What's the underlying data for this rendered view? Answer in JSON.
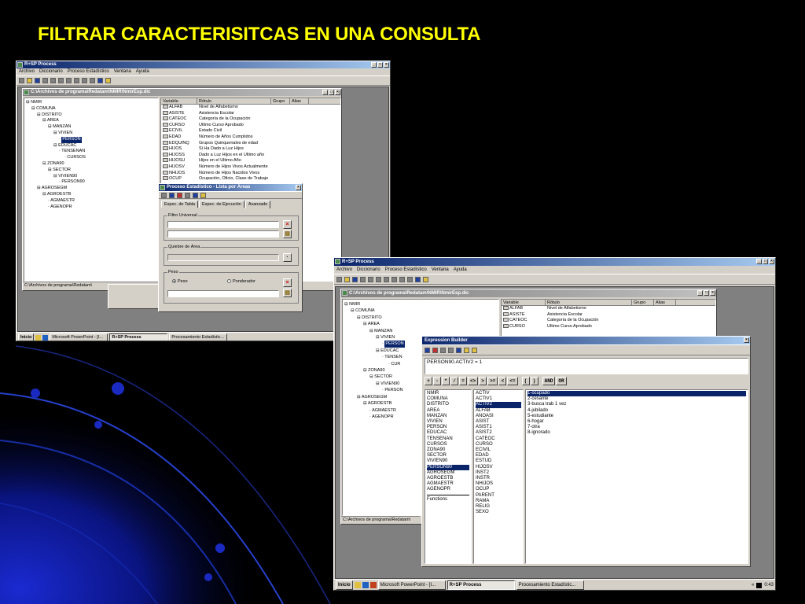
{
  "slide_title": "FILTRAR CARACTERISITCAS EN UNA CONSULTA",
  "colors": {
    "title": "#ffff00",
    "titlebar": "#0a246a",
    "window": "#d4d0c8",
    "desktop": "#808080"
  },
  "app": {
    "title": "R+SP Process",
    "menu": [
      "Archivo",
      "Diccionario",
      "Proceso Estadístico",
      "Ventana",
      "Ayuda"
    ]
  },
  "dict_window_1": {
    "title": "C:\\Archivos de programa\\Redatam\\NMIR\\NmirEsp.dic"
  },
  "dict_window_2": {
    "title": "C:\\Archivos de programa\\Redatam\\NMIR\\NmirEsp.dic"
  },
  "tree": [
    {
      "label": "NMIR",
      "level": 0
    },
    {
      "label": "COMUNA",
      "level": 1
    },
    {
      "label": "DISTRITO",
      "level": 2
    },
    {
      "label": "AREA",
      "level": 3
    },
    {
      "label": "MANZAN",
      "level": 4
    },
    {
      "label": "VIVIEN",
      "level": 5
    },
    {
      "label": "PERSON",
      "level": 6,
      "selected": true
    },
    {
      "label": "EDUCAC",
      "level": 5
    },
    {
      "label": "TENSENAN",
      "level": 6
    },
    {
      "label": "CURSOS",
      "level": 7
    },
    {
      "label": "ZONA90",
      "level": 3
    },
    {
      "label": "SECTOR",
      "level": 4
    },
    {
      "label": "VIVIEN90",
      "level": 5
    },
    {
      "label": "PERSON90",
      "level": 6
    },
    {
      "label": "AGROSEGM",
      "level": 2
    },
    {
      "label": "AGROESTB",
      "level": 3
    },
    {
      "label": "AGMAESTR",
      "level": 4
    },
    {
      "label": "AGENOPR",
      "level": 4
    }
  ],
  "tree2": [
    {
      "label": "NMIR",
      "level": 0
    },
    {
      "label": "COMUNA",
      "level": 1
    },
    {
      "label": "DISTRITO",
      "level": 2
    },
    {
      "label": "AREA",
      "level": 3
    },
    {
      "label": "MANZAN",
      "level": 4
    },
    {
      "label": "VIVIEN",
      "level": 5
    },
    {
      "label": "PERSON",
      "level": 6,
      "selected": true
    },
    {
      "label": "EDUCAC",
      "level": 5
    },
    {
      "label": "TENSEN",
      "level": 6
    },
    {
      "label": "CUR",
      "level": 7
    },
    {
      "label": "ZONA90",
      "level": 3
    },
    {
      "label": "SECTOR",
      "level": 4
    },
    {
      "label": "VIVIEN90",
      "level": 5
    },
    {
      "label": "PERSON",
      "level": 6
    },
    {
      "label": "AGROSEGM",
      "level": 2
    },
    {
      "label": "AGROESTB",
      "level": 3
    },
    {
      "label": "AGMAESTR",
      "level": 4
    },
    {
      "label": "AGENOPR",
      "level": 4
    }
  ],
  "var_columns": [
    "Variable",
    "Rótulo",
    "Grupo",
    "Alias"
  ],
  "variables": [
    {
      "name": "ALFAB",
      "label": "Nivel de Alfabetismo"
    },
    {
      "name": "ASISTE",
      "label": "Asistencia Escolar"
    },
    {
      "name": "CATEOC",
      "label": "Categoría de la Ocupación"
    },
    {
      "name": "CURSO",
      "label": "Ultimo Curso Aprobado"
    },
    {
      "name": "ECIVIL",
      "label": "Estado Civil"
    },
    {
      "name": "EDAD",
      "label": "Número de Años Cumplidos"
    },
    {
      "name": "EDQUINQ",
      "label": "Grupos Quinquenales de edad"
    },
    {
      "name": "HIJOS",
      "label": "Si Ha Dado a Luz Hijos"
    },
    {
      "name": "HIJOSS",
      "label": "Dado a Luz Hijos en el Ultimo año"
    },
    {
      "name": "HIJOSU",
      "label": "Hijos en el Ultimo Año"
    },
    {
      "name": "HIJOSV",
      "label": "Número de Hijos Vivos Actualmente"
    },
    {
      "name": "NHIJOS",
      "label": "Número de Hijos Nacidos Vivos"
    },
    {
      "name": "OCUP",
      "label": "Ocupación, Oficio, Clase de Trabajo"
    }
  ],
  "variables2": [
    {
      "name": "ALFAB",
      "label": "Nivel de Alfabetismo"
    },
    {
      "name": "ASISTE",
      "label": "Asistencia Escolar"
    },
    {
      "name": "CATEOC",
      "label": "Categoría de la Ocupación"
    },
    {
      "name": "CURSO",
      "label": "Ultimo Curso Aprobado"
    }
  ],
  "status_path": "C:\\Archivos de programa\\Redatam\\",
  "proc_dialog": {
    "title": "Proceso Estadístico - Lista por Áreas",
    "tabs": [
      "Espec. de Tabla",
      "Espec. de Ejecución",
      "Avanzado"
    ],
    "active_tab": 2,
    "filtro_label": "Filtro Universal",
    "quiebre_label": "Quiebre de Área",
    "peso_label": "Peso",
    "radio_peso": "Peso",
    "radio_ponderador": "Ponderador"
  },
  "expr_builder": {
    "title": "Expression Builder",
    "expression": "PERSON90.ACTIV2 = 1",
    "operators": [
      "+",
      "-",
      "*",
      "/",
      "=",
      "<>",
      ">",
      ">=",
      "<",
      "<=",
      "(",
      ")",
      "AND",
      "OR"
    ],
    "entities": [
      "NMIR",
      "COMUNA",
      "DISTRITO",
      "AREA",
      "MANZAN",
      "VIVIEN",
      "PERSON",
      "EDUCAC",
      "TENSENAN",
      "CURSOS",
      "ZONA90",
      "SECTOR",
      "VIVIEN90",
      "PERSON90",
      "AGROSEGM",
      "AGROESTB",
      "AGMAESTR",
      "AGENOPR"
    ],
    "entities_selected": 13,
    "functions_label": "Functions",
    "variables": [
      "ACTIV",
      "ACTIV1",
      "ACTIV2",
      "ALFAB",
      "ANOASI",
      "ASIST",
      "ASIST1",
      "ASIST2",
      "CATEOC",
      "CURSO",
      "ECIVIL",
      "EDAD",
      "ESTUD",
      "HIJOSV",
      "INST2",
      "INSTR",
      "NHIJOS",
      "OCUP",
      "PARENT",
      "RAMA",
      "RELIG",
      "SEXO"
    ],
    "variables_selected": 2,
    "values": [
      "1-ocupado",
      "2-cesante",
      "3-busca trab 1 vez",
      "4-jubilado",
      "5-estudiante",
      "6-hogar",
      "7-otra",
      "8-ignorado"
    ],
    "values_selected": 0
  },
  "taskbar1": {
    "start": "Inicio",
    "items": [
      "Microsoft PowerPoint - [I...",
      "R+SP Process",
      "Procesamiento Estadístic..."
    ],
    "active": 1
  },
  "taskbar2": {
    "start": "Inicio",
    "items": [
      "Microsoft PowerPoint - [I...",
      "R+SP Process",
      "Procesamiento Estadístic..."
    ],
    "active": 1,
    "clock": "0:43"
  }
}
